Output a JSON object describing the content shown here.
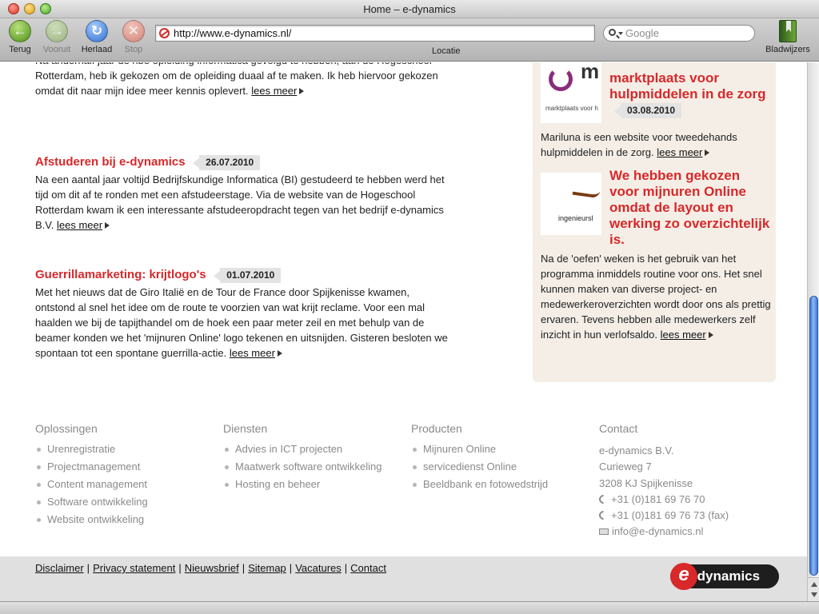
{
  "window": {
    "title": "Home – e-dynamics"
  },
  "toolbar": {
    "back_label": "Terug",
    "forward_label": "Vooruit",
    "reload_label": "Herlaad",
    "stop_label": "Stop",
    "url": "http://www.e-dynamics.nl/",
    "url_label": "Locatie",
    "search_placeholder": "Google",
    "bookmarks_label": "Bladwijzers"
  },
  "articles": [
    {
      "title": "",
      "date": "",
      "body": "Na anderhalf jaar de hbo opleiding informatica gevolgd te hebben, aan de Hogeschool Rotterdam, heb ik gekozen om de opleiding duaal af te maken. Ik heb hiervoor gekozen omdat dit naar mijn idee meer kennis oplevert.",
      "more": "lees meer"
    },
    {
      "title": "Afstuderen bij e-dynamics",
      "date": "26.07.2010",
      "body": "Na een aantal jaar voltijd Bedrijfskundige Informatica (BI) gestudeerd te hebben werd het tijd om dit af te ronden met een afstudeerstage. Via de website van de Hogeschool Rotterdam kwam ik een interessante afstudeeropdracht tegen van het bedrijf e-dynamics B.V.",
      "more": "lees meer"
    },
    {
      "title": "Guerrillamarketing: krijtlogo's",
      "date": "01.07.2010",
      "body": "Met het nieuws dat de Giro Italië en de Tour de France door Spijkenisse kwamen, ontstond al snel het idee om de route te voorzien van wat krijt reclame. Voor een mal haalden we bij de tapijthandel om de hoek een paar meter zeil en met behulp van de beamer konden we het 'mijnuren Online' logo tekenen en uitsnijden. Gisteren besloten we spontaan tot een spontane guerrilla-actie.",
      "more": "lees meer"
    }
  ],
  "sidebar": {
    "refs": [
      {
        "title": "marktplaats voor hulpmiddelen in de zorg",
        "date": "03.08.2010",
        "thumb_text": "marktplaats voor h",
        "thumb_letter": "m",
        "body": "Mariluna is een website voor tweedehands hulpmiddelen in de zorg.",
        "more": "lees meer"
      },
      {
        "title": "We hebben gekozen voor mijnuren Online omdat de layout en werking zo overzichtelijk is.",
        "thumb_text": "ingenieursl",
        "body": "Na de 'oefen' weken is het gebruik van het programma inmiddels routine voor ons. Het snel kunnen maken van diverse project- en medewerkeroverzichten wordt door ons als prettig ervaren. Tevens hebben alle medewerkers zelf inzicht in hun verlofsaldo.",
        "more": "lees meer"
      }
    ]
  },
  "footer": {
    "columns": [
      {
        "heading": "Oplossingen",
        "items": [
          "Urenregistratie",
          "Projectmanagement",
          "Content management",
          "Software ontwikkeling",
          "Website ontwikkeling"
        ]
      },
      {
        "heading": "Diensten",
        "items": [
          "Advies in ICT projecten",
          "Maatwerk software ontwikkeling",
          "Hosting en beheer"
        ]
      },
      {
        "heading": "Producten",
        "items": [
          "Mijnuren Online",
          "servicedienst Online",
          "Beeldbank en fotowedstrijd"
        ]
      }
    ],
    "contact": {
      "heading": "Contact",
      "company": "e-dynamics B.V.",
      "street": "Curieweg 7",
      "city": "3208 KJ Spijkenisse",
      "phone": "+31 (0)181 69 76 70",
      "fax": "+31 (0)181 69 76 73 (fax)",
      "email": "info@e-dynamics.nl"
    },
    "links": [
      "Disclaimer",
      "Privacy statement",
      "Nieuwsbrief",
      "Sitemap",
      "Vacatures",
      "Contact"
    ],
    "logo_text": "-dynamics",
    "logo_letter": "e"
  }
}
